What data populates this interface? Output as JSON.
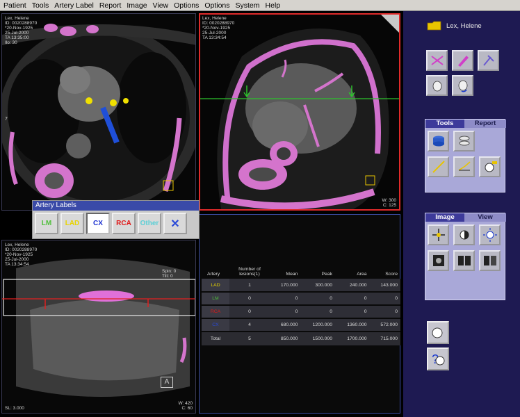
{
  "menu": [
    "Patient",
    "Tools",
    "Artery Label",
    "Report",
    "Image",
    "View",
    "Options",
    "Options",
    "System",
    "Help"
  ],
  "viewports": {
    "top_left": {
      "info_lines": [
        "Lex, Helene",
        "ID: 0020288970",
        "*20-Nov-1925",
        "25-Jul-2000",
        "TA 13:35:00",
        "Ilo: 30"
      ],
      "label": "7"
    },
    "top_right": {
      "info_lines": [
        "Lex, Helene",
        "ID: 0020288970",
        "*20-Nov-1925",
        "25-Jul-2000",
        "TA 13:34:54"
      ],
      "window_lines": [
        "W: 300",
        "C: 125"
      ]
    },
    "bottom_left": {
      "info_lines": [
        "Lex, Helene",
        "ID: 0020288970",
        "*20-Nov-1925",
        "25-Jul-2000",
        "TA 13:34:54"
      ],
      "spin_text": "Spin: 0",
      "tilt_text": "Tilt: 0",
      "marker_letter": "A",
      "bottom_left_text": "SL: 3.000",
      "window_lines": [
        "W: 420",
        "C: 60"
      ]
    }
  },
  "artery_dialog": {
    "title": "Artery Labels",
    "buttons": [
      {
        "label": "LM",
        "color": "#4fbf3a"
      },
      {
        "label": "LAD",
        "color": "#e8d400"
      },
      {
        "label": "CX",
        "color": "#1a2fd0"
      },
      {
        "label": "RCA",
        "color": "#e01818"
      },
      {
        "label": "Other",
        "color": "#5ccfd6"
      },
      {
        "label": "✕",
        "color": "#2a4ad8"
      }
    ]
  },
  "score_table": {
    "headers": [
      "Artery",
      "Number of lesions(1)",
      "Mean",
      "Peak",
      "Area",
      "Score"
    ],
    "rows": [
      {
        "artery": "LAD",
        "color": "#e8d400",
        "cells": [
          "1",
          "170.000",
          "300.000",
          "240.000",
          "143.000"
        ]
      },
      {
        "artery": "LM",
        "color": "#4fbf3a",
        "cells": [
          "0",
          "0",
          "0",
          "0",
          "0"
        ]
      },
      {
        "artery": "RCA",
        "color": "#e01818",
        "cells": [
          "0",
          "0",
          "0",
          "0",
          "0"
        ]
      },
      {
        "artery": "CX",
        "color": "#2a4ad8",
        "cells": [
          "4",
          "680.000",
          "1200.000",
          "1360.000",
          "572.000"
        ]
      }
    ],
    "total": {
      "label": "Total",
      "cells": [
        "5",
        "850.000",
        "1500.000",
        "1700.000",
        "715.000"
      ]
    }
  },
  "right_panel": {
    "patient_name": "Lex, Helene",
    "tools_tabs": [
      "Tools",
      "Report"
    ],
    "image_tabs": [
      "Image",
      "View"
    ]
  },
  "colors": {
    "calcium_overlay": "#e070d8",
    "active_viewport_border": "#e02a2a",
    "panel_background": "#1e1a52"
  }
}
